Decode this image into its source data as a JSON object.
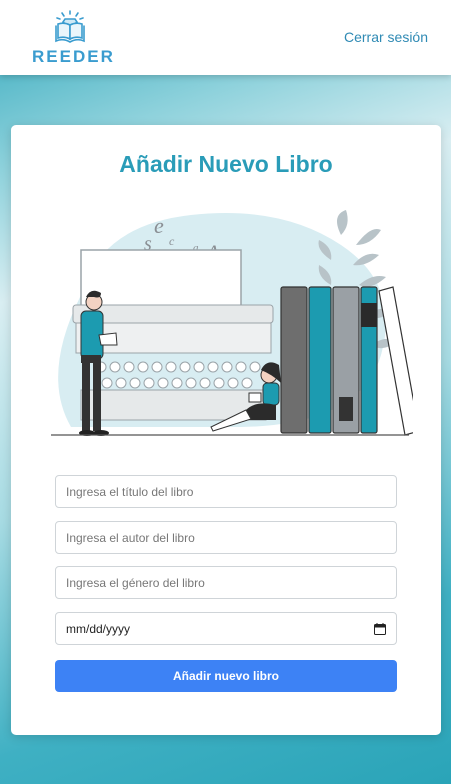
{
  "header": {
    "logo_text": "REEDER",
    "logout_label": "Cerrar sesión"
  },
  "form": {
    "title": "Añadir Nuevo Libro",
    "title_placeholder": "Ingresa el título del libro",
    "author_placeholder": "Ingresa el autor del libro",
    "genre_placeholder": "Ingresa el género del libro",
    "date_value": "mm/dd/yyyy",
    "submit_label": "Añadir nuevo libro"
  },
  "colors": {
    "accent": "#2a9cb8",
    "button": "#3d82f5",
    "logo": "#3a9ccf"
  },
  "icons": {
    "logo": "book-diamond-icon",
    "calendar": "calendar-icon"
  }
}
